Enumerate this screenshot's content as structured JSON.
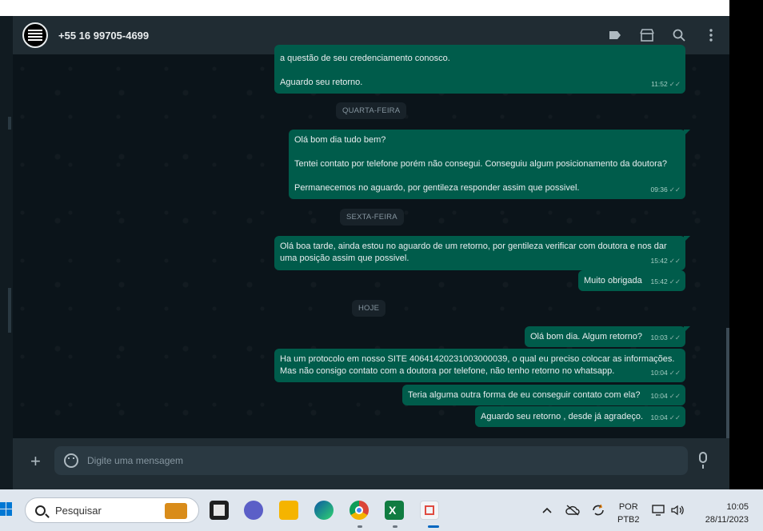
{
  "chat": {
    "contact_name": "+55 16 99705-4699",
    "header_icons": [
      "label-icon",
      "store-icon",
      "search-icon",
      "menu-icon"
    ],
    "messages": [
      {
        "text": "a questão de seu credenciamento conosco.\n\nAguardo seu retorno.",
        "time": "11:52"
      },
      {
        "text": "Olá bom dia tudo bem?\n\nTentei contato por telefone porém não consegui. Conseguiu algum posicionamento da doutora?\n\nPermanecemos no aguardo, por gentileza responder assim que possivel.",
        "time": "09:36"
      },
      {
        "text": "Olá boa tarde, ainda estou no aguardo de um retorno, por gentileza verificar com doutora e nos dar uma posição assim que possivel.",
        "time": "15:42"
      },
      {
        "text": "Muito obrigada",
        "time": "15:42"
      },
      {
        "text": "Olá bom dia. Algum retorno?",
        "time": "10:03"
      },
      {
        "text": "Ha um protocolo em nosso SITE 40641420231003000039, o qual eu preciso colocar as informações. Mas não consigo contato com a doutora por telefone, não tenho retorno no whatsapp.",
        "time": "10:04"
      },
      {
        "text": "Teria alguma outra forma de eu conseguir contato com ela?",
        "time": "10:04"
      },
      {
        "text": "Aguardo seu retorno , desde já agradeço.",
        "time": "10:04"
      }
    ],
    "day_labels": [
      "QUARTA-FEIRA",
      "SEXTA-FEIRA",
      "HOJE"
    ],
    "composer_placeholder": "Digite uma mensagem",
    "colors": {
      "outgoing_bubble": "#005c4b",
      "background": "#0b141a",
      "header": "#202c33"
    }
  },
  "taskbar": {
    "search_placeholder": "Pesquisar",
    "apps": [
      "explorer-icon",
      "zoom-icon",
      "folder-icon",
      "edge-icon",
      "chrome-icon",
      "excel-icon",
      "snipping-tool-icon"
    ],
    "language_line1": "POR",
    "language_line2": "PTB2",
    "time": "10:05",
    "date": "28/11/2023"
  }
}
